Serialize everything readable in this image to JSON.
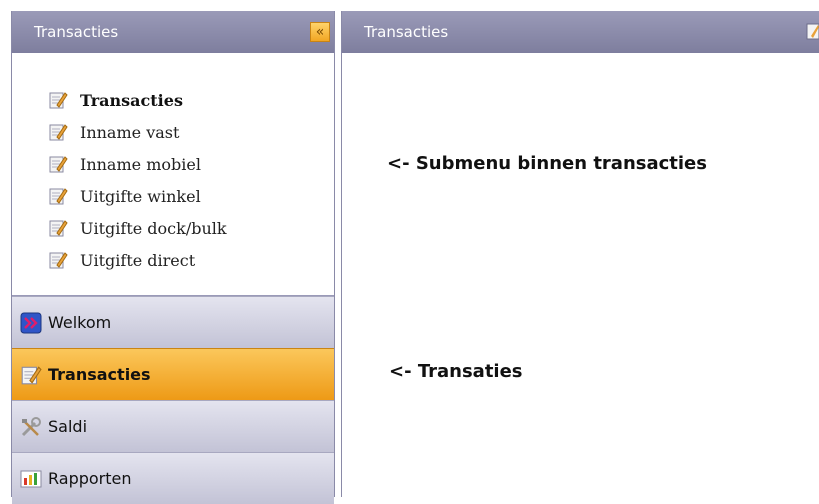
{
  "left_panel": {
    "title": "Transacties",
    "collapse_label": "«",
    "submenu": [
      {
        "label": "Transacties",
        "icon": "edit-icon",
        "active": true
      },
      {
        "label": "Inname vast",
        "icon": "edit-icon"
      },
      {
        "label": "Inname mobiel",
        "icon": "edit-icon"
      },
      {
        "label": "Uitgifte winkel",
        "icon": "edit-icon"
      },
      {
        "label": "Uitgifte dock/bulk",
        "icon": "edit-icon"
      },
      {
        "label": "Uitgifte direct",
        "icon": "edit-icon"
      }
    ],
    "nav": [
      {
        "label": "Welkom",
        "icon": "welcome-icon"
      },
      {
        "label": "Transacties",
        "icon": "edit-icon",
        "selected": true
      },
      {
        "label": "Saldi",
        "icon": "tools-icon"
      },
      {
        "label": "Rapporten",
        "icon": "report-icon"
      }
    ]
  },
  "right_panel": {
    "title": "Transacties"
  },
  "annotations": {
    "submenu_note": "<- Submenu binnen transacties",
    "nav_note": "<- Transaties"
  },
  "colors": {
    "titlebar": "#8a8aaa",
    "accent": "#f2a623",
    "nav_bg": "#d3d3e2"
  }
}
